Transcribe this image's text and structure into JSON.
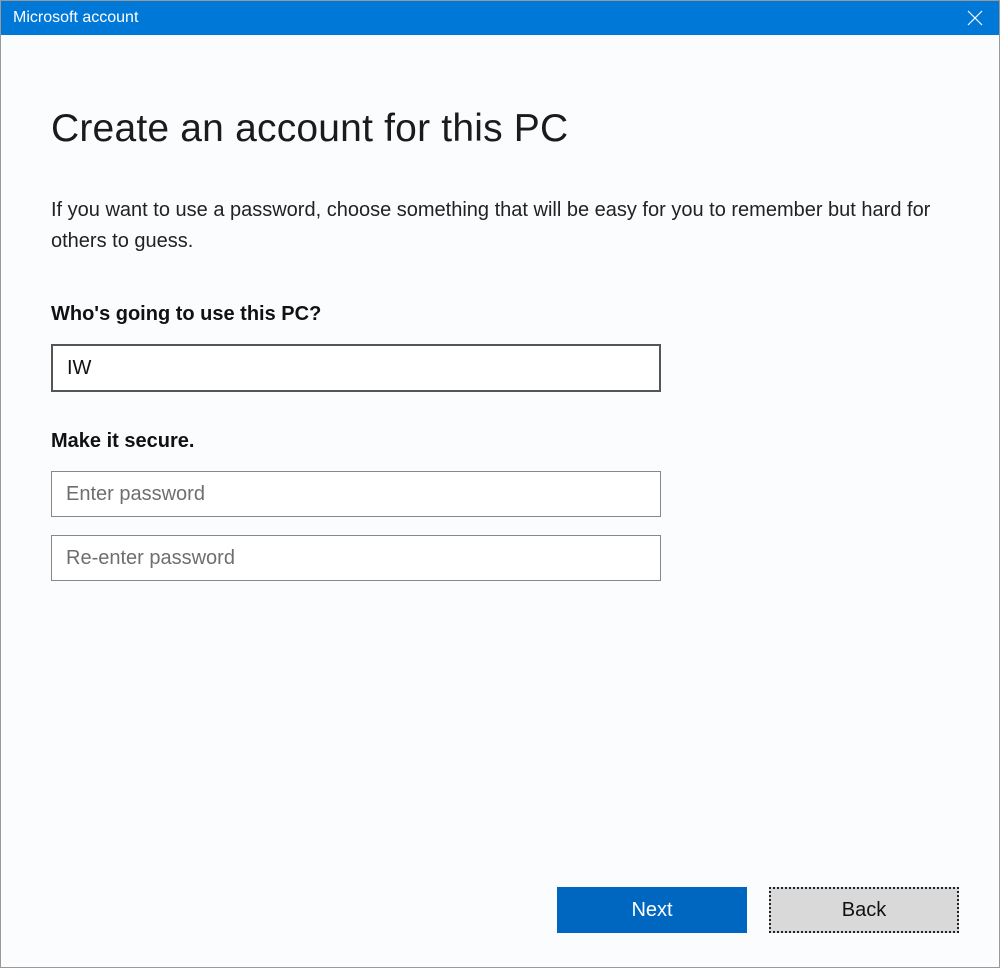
{
  "titlebar": {
    "title": "Microsoft account"
  },
  "main": {
    "heading": "Create an account for this PC",
    "description": "If you want to use a password, choose something that will be easy for you to remember but hard for others to guess.",
    "username": {
      "label": "Who's going to use this PC?",
      "value": "IW"
    },
    "password": {
      "label": "Make it secure.",
      "enter_placeholder": "Enter password",
      "reenter_placeholder": "Re-enter password"
    }
  },
  "footer": {
    "next": "Next",
    "back": "Back"
  }
}
